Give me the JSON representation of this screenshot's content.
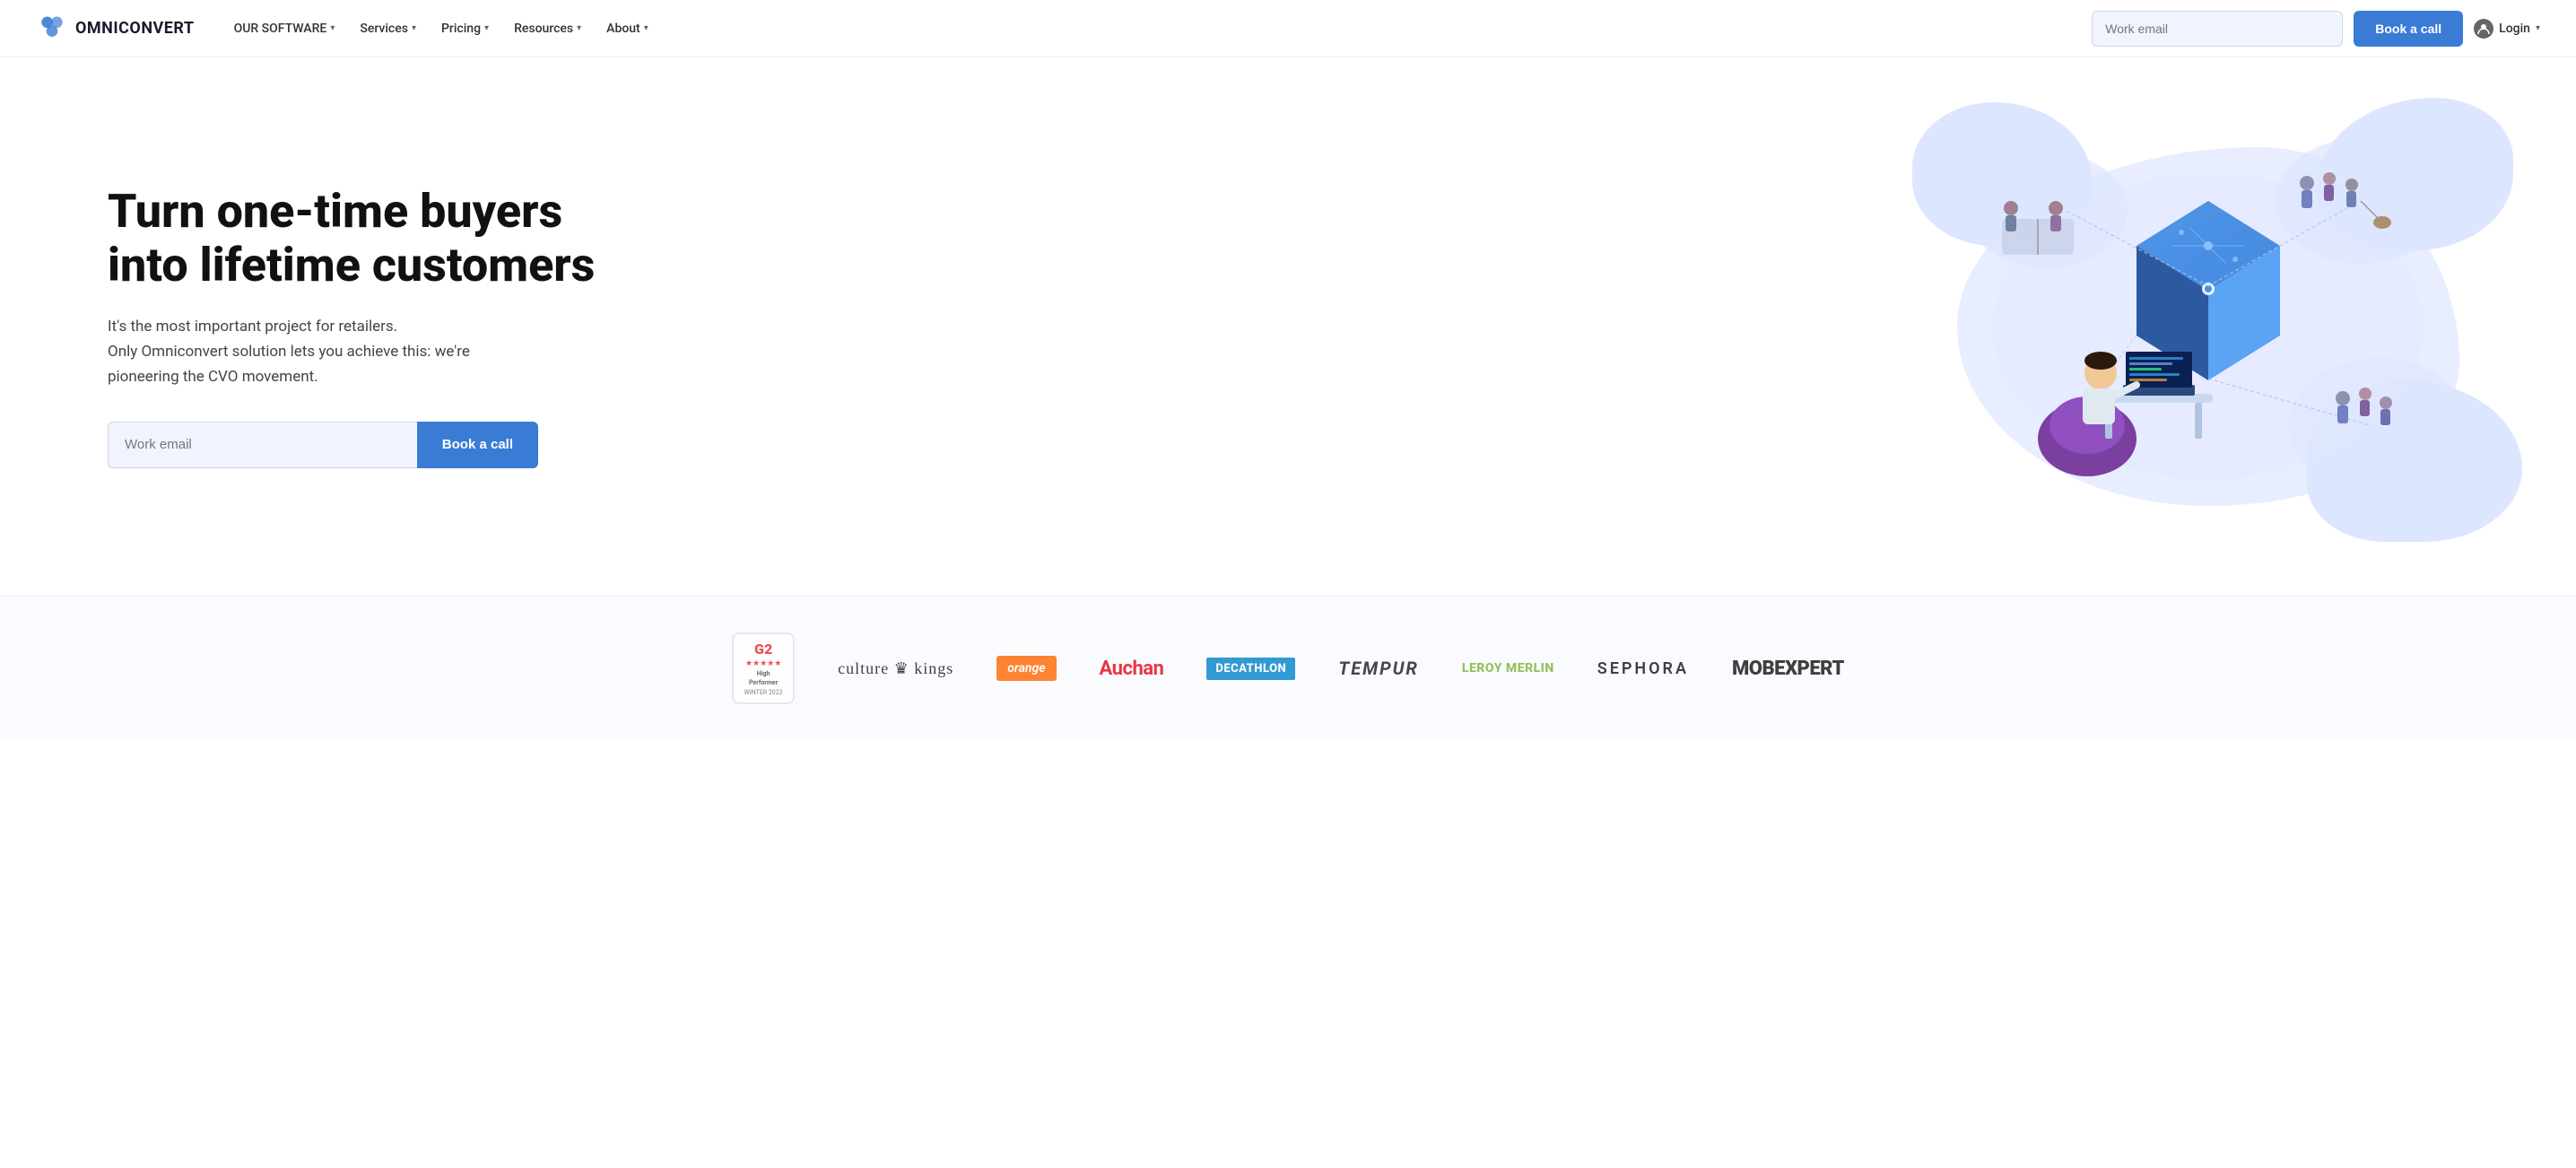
{
  "nav": {
    "logo_text": "OMNICONVERT",
    "items": [
      {
        "label": "OUR SOFTWARE",
        "has_dropdown": true
      },
      {
        "label": "Services",
        "has_dropdown": true
      },
      {
        "label": "Pricing",
        "has_dropdown": true
      },
      {
        "label": "Resources",
        "has_dropdown": true
      },
      {
        "label": "About",
        "has_dropdown": true
      }
    ],
    "email_placeholder": "Work email",
    "book_call_label": "Book a call",
    "login_label": "Login"
  },
  "hero": {
    "title": "Turn one-time buyers into lifetime customers",
    "subtitle_line1": "It's the most important project for retailers.",
    "subtitle_line2": "Only Omniconvert solution lets you achieve this: we're",
    "subtitle_line3": "pioneering the CVO movement.",
    "email_placeholder": "Work email",
    "book_call_label": "Book a call"
  },
  "logos": {
    "g2_badge": {
      "logo": "G",
      "line1": "High",
      "line2": "Performer",
      "line3": "WINTER 2022"
    },
    "brands": [
      {
        "name": "culture-kings",
        "display": "culture ♛ kings"
      },
      {
        "name": "orange",
        "display": "orange"
      },
      {
        "name": "auchan",
        "display": "Auchan"
      },
      {
        "name": "decathlon",
        "display": "DECATHLON"
      },
      {
        "name": "tempur",
        "display": "TEMPUR"
      },
      {
        "name": "leroy-merlin",
        "display": "LEROY MERLIN"
      },
      {
        "name": "sephora",
        "display": "SEPHORA"
      },
      {
        "name": "mobexpert",
        "display": "MOBEXPERT"
      }
    ]
  }
}
